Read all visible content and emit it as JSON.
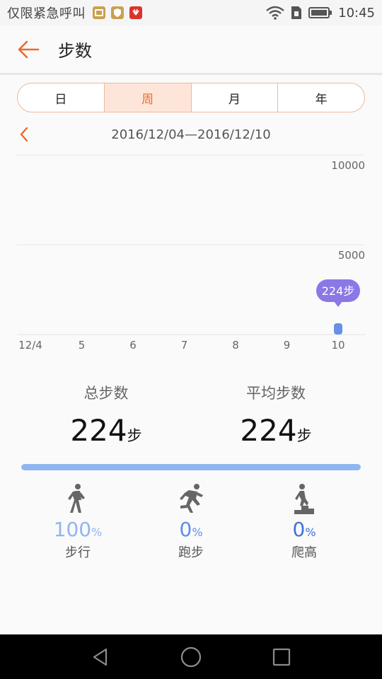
{
  "status_bar": {
    "carrier": "仅限紧急呼叫",
    "time": "10:45"
  },
  "app_bar": {
    "title": "步数"
  },
  "tabs": [
    {
      "label": "日",
      "active": false
    },
    {
      "label": "周",
      "active": true
    },
    {
      "label": "月",
      "active": false
    },
    {
      "label": "年",
      "active": false
    }
  ],
  "date_range": "2016/12/04—2016/12/10",
  "chart_data": {
    "type": "bar",
    "categories": [
      "12/4",
      "5",
      "6",
      "7",
      "8",
      "9",
      "10"
    ],
    "values": [
      0,
      0,
      0,
      0,
      0,
      0,
      224
    ],
    "y_ticks": [
      "10000",
      "5000"
    ],
    "ylim": [
      0,
      10000
    ],
    "tooltip": {
      "category": "10",
      "text": "224步"
    },
    "bar_color": "#6a8fe8",
    "tooltip_color": "#8b77e6"
  },
  "stats": {
    "total": {
      "label": "总步数",
      "value": "224",
      "unit": "步"
    },
    "average": {
      "label": "平均步数",
      "value": "224",
      "unit": "步"
    }
  },
  "progress_fraction": 1.0,
  "activities": [
    {
      "icon": "walking-icon",
      "percent": "100",
      "pct_sign": "%",
      "label": "步行",
      "color": "#8fb6f0"
    },
    {
      "icon": "running-icon",
      "percent": "0",
      "pct_sign": "%",
      "label": "跑步",
      "color": "#5b8fe6"
    },
    {
      "icon": "climbing-icon",
      "percent": "0",
      "pct_sign": "%",
      "label": "爬高",
      "color": "#3f73d8"
    }
  ],
  "colors": {
    "accent": "#ea6b2d",
    "tab_active_bg": "#fde6d9"
  }
}
